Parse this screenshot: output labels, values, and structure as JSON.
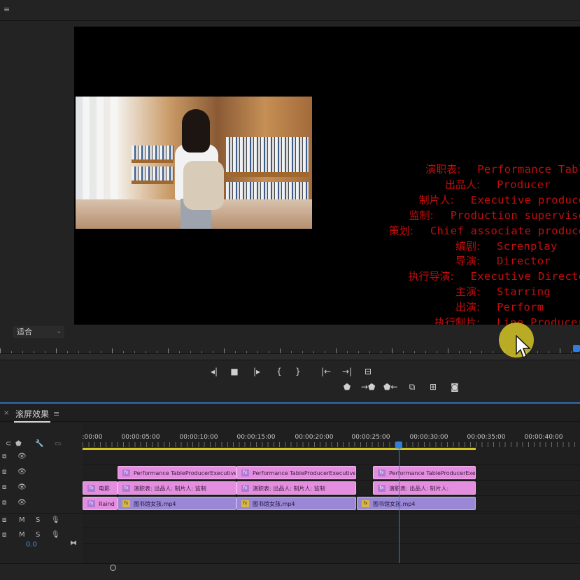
{
  "topbar": {
    "menu_icon": "≡"
  },
  "monitor": {
    "fit_select": {
      "value": "适合"
    },
    "credits": [
      {
        "cn": "演职表:",
        "en": "Performance Table"
      },
      {
        "cn": "出品人:",
        "en": "Producer"
      },
      {
        "cn": "制片人:",
        "en": "Executive producer"
      },
      {
        "cn": "监制:",
        "en": "Production supervisor"
      },
      {
        "cn": "策划:",
        "en": "Chief associate producer"
      },
      {
        "cn": "编剧:",
        "en": "Screnplay"
      },
      {
        "cn": "导演:",
        "en": "Director"
      },
      {
        "cn": "执行导演:",
        "en": "Executive Director"
      },
      {
        "cn": "主演:",
        "en": "Starring"
      },
      {
        "cn": "出演:",
        "en": "Perform"
      },
      {
        "cn": "执行制片:",
        "en": "Line Producer"
      }
    ],
    "transport": {
      "row1": [
        {
          "name": "step-back-icon",
          "glyph": "◂|"
        },
        {
          "name": "stop-icon",
          "glyph": "■"
        },
        {
          "name": "step-forward-icon",
          "glyph": "|▸"
        },
        {
          "name": "mark-in-icon",
          "glyph": "{"
        },
        {
          "name": "mark-out-icon",
          "glyph": "}"
        },
        {
          "name": "go-to-in-icon",
          "glyph": "|←"
        },
        {
          "name": "go-to-out-icon",
          "glyph": "→|"
        },
        {
          "name": "lift-extract-icon",
          "glyph": "⊟"
        }
      ],
      "row2": [
        {
          "name": "add-marker-icon",
          "glyph": "⬟"
        },
        {
          "name": "insert-icon",
          "glyph": "→⬟"
        },
        {
          "name": "overwrite-icon",
          "glyph": "⬟←"
        },
        {
          "name": "export-frame-icon",
          "glyph": "⧉"
        },
        {
          "name": "compare-icon",
          "glyph": "⊞"
        },
        {
          "name": "camera-icon",
          "glyph": "◙"
        }
      ]
    }
  },
  "timeline": {
    "tab": {
      "close": "×",
      "title": "滚屏效果",
      "menu": "≡"
    },
    "timecodes": [
      ":00:00",
      "00:00:05:00",
      "00:00:10:00",
      "00:00:15:00",
      "00:00:20:00",
      "00:00:25:00",
      "00:00:30:00",
      "00:00:35:00",
      "00:00:40:00"
    ],
    "tracks": {
      "v4": {
        "clips": [
          {
            "label": "Performance TableProducerExecutive pr"
          },
          {
            "label": "Performance TableProducerExecutive pr"
          },
          {
            "label": "Performance TableProducerExec"
          }
        ]
      },
      "v3": {
        "clips": [
          {
            "label": "电影"
          },
          {
            "label": "演职表: 出品人: 制片人: 监制"
          },
          {
            "label": "演职表: 出品人: 制片人: 监制"
          },
          {
            "label": "演职表: 出品人: 制片人:"
          }
        ]
      },
      "v2": {
        "clips": [
          {
            "label": "Raind"
          },
          {
            "label": "图书馆女孩.mp4"
          },
          {
            "label": "图书馆女孩.mp4"
          },
          {
            "label": "图书馆女孩.mp4"
          }
        ]
      }
    },
    "audio": {
      "mute": "M",
      "solo": "S"
    },
    "value": "0.0"
  },
  "colors": {
    "accent": "#2f7de1",
    "graphic_clip": "#e48ee0",
    "video_clip": "#9a88d6",
    "credits_text": "#c40d0d",
    "work_area": "#d4c420"
  }
}
